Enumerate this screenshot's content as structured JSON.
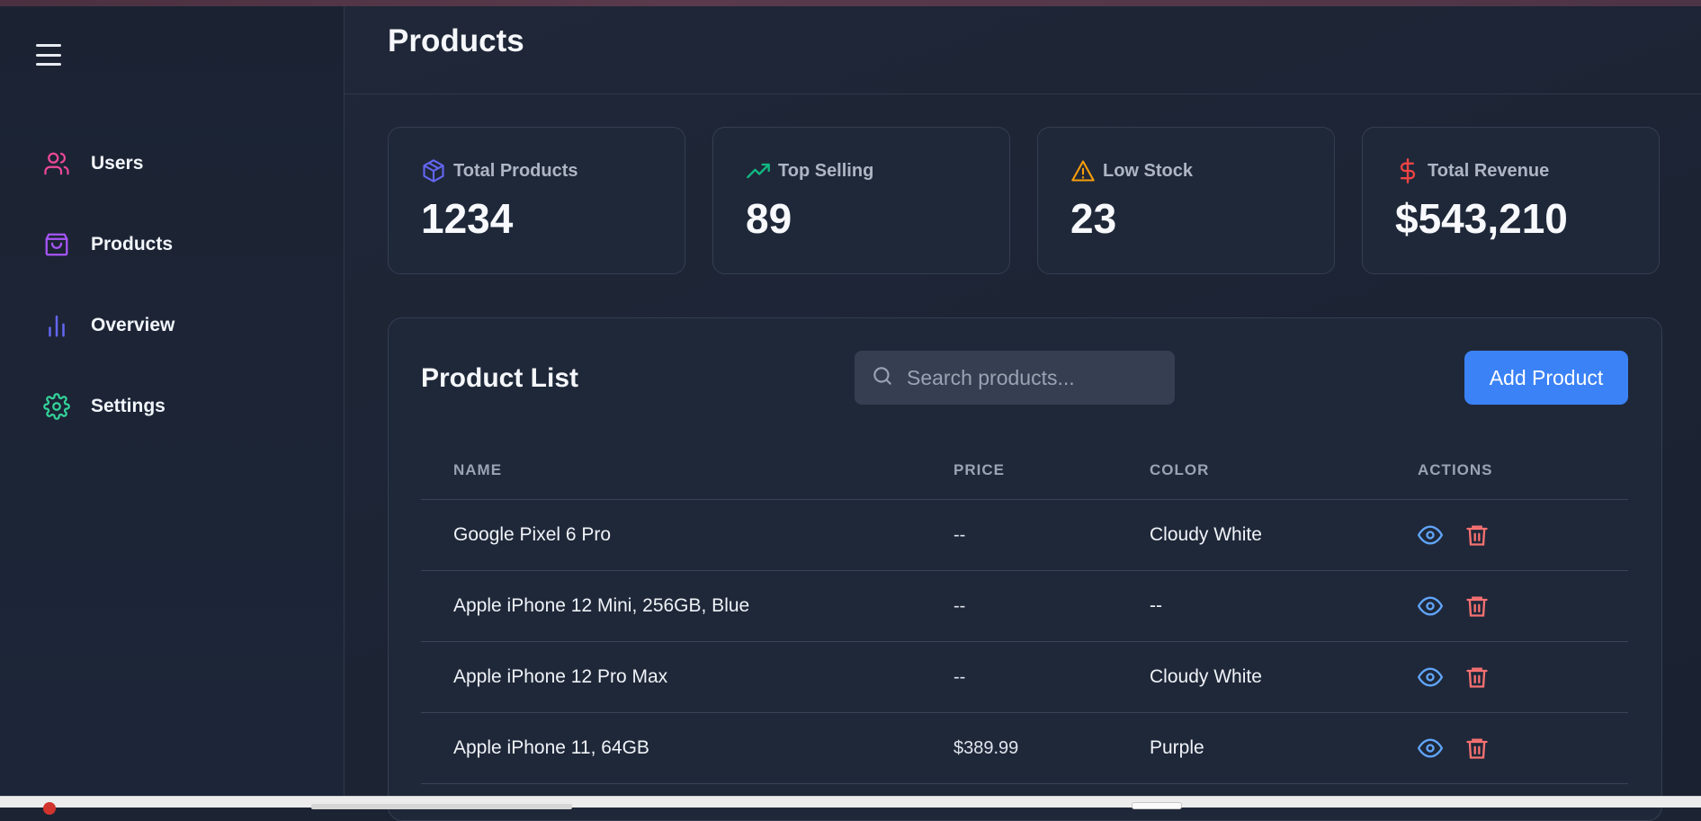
{
  "header": {
    "title": "Products"
  },
  "sidebar": {
    "items": [
      {
        "label": "Users",
        "icon": "users-icon",
        "color": "#ec4899"
      },
      {
        "label": "Products",
        "icon": "shopping-bag-icon",
        "color": "#a855f7"
      },
      {
        "label": "Overview",
        "icon": "bar-chart-icon",
        "color": "#6366f1"
      },
      {
        "label": "Settings",
        "icon": "gear-icon",
        "color": "#34d399"
      }
    ]
  },
  "stats": [
    {
      "title": "Total Products",
      "value": "1234",
      "icon": "package-icon",
      "color": "#6366f1"
    },
    {
      "title": "Top Selling",
      "value": "89",
      "icon": "trending-up-icon",
      "color": "#10b981"
    },
    {
      "title": "Low Stock",
      "value": "23",
      "icon": "alert-triangle-icon",
      "color": "#f59e0b"
    },
    {
      "title": "Total Revenue",
      "value": "$543,210",
      "icon": "dollar-icon",
      "color": "#ef4444"
    }
  ],
  "product_list": {
    "title": "Product List",
    "search_placeholder": "Search products...",
    "add_button": "Add Product",
    "columns": [
      "NAME",
      "PRICE",
      "COLOR",
      "ACTIONS"
    ],
    "rows": [
      {
        "name": "Google Pixel 6 Pro",
        "price": "--",
        "color": "Cloudy White"
      },
      {
        "name": "Apple iPhone 12 Mini, 256GB, Blue",
        "price": "--",
        "color": "--"
      },
      {
        "name": "Apple iPhone 12 Pro Max",
        "price": "--",
        "color": "Cloudy White"
      },
      {
        "name": "Apple iPhone 11, 64GB",
        "price": "$389.99",
        "color": "Purple"
      }
    ]
  },
  "colors": {
    "accent": "#3b82f6",
    "view_icon": "#60a5fa",
    "delete_icon": "#f87171"
  }
}
